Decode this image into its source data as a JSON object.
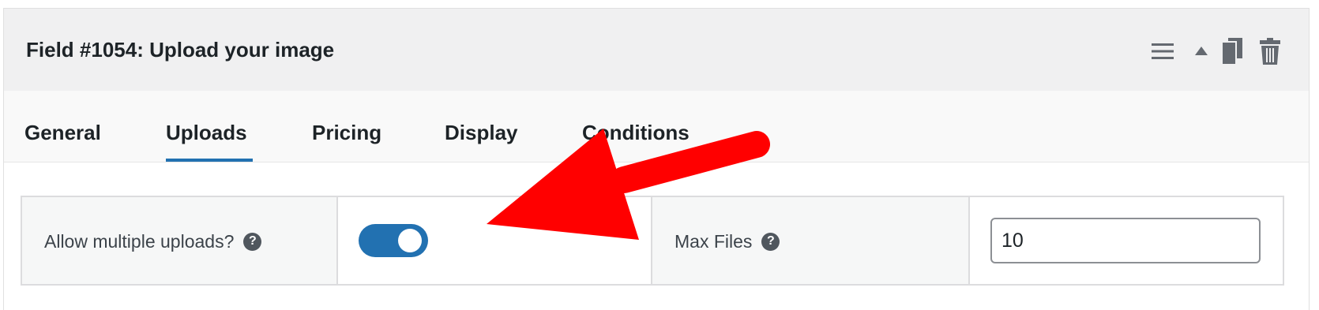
{
  "field": {
    "title": "Field #1054: Upload your image"
  },
  "header_actions": [
    {
      "name": "drag-handle-icon",
      "icon": "hamburger"
    },
    {
      "name": "collapse-arrow-icon",
      "icon": "triangle-up"
    },
    {
      "name": "duplicate-icon",
      "icon": "copy"
    },
    {
      "name": "delete-icon",
      "icon": "trash"
    }
  ],
  "tabs": [
    {
      "label": "General",
      "active": false
    },
    {
      "label": "Uploads",
      "active": true
    },
    {
      "label": "Pricing",
      "active": false
    },
    {
      "label": "Display",
      "active": false
    },
    {
      "label": "Conditions",
      "active": false
    }
  ],
  "settings": {
    "multiple_uploads": {
      "label": "Allow multiple uploads?",
      "help": "?",
      "enabled": true
    },
    "max_files": {
      "label": "Max Files",
      "help": "?",
      "value": "10"
    }
  },
  "colors": {
    "accent": "#2271b1",
    "annotation_arrow": "#ff0000",
    "header_bg": "#f0f0f1"
  }
}
